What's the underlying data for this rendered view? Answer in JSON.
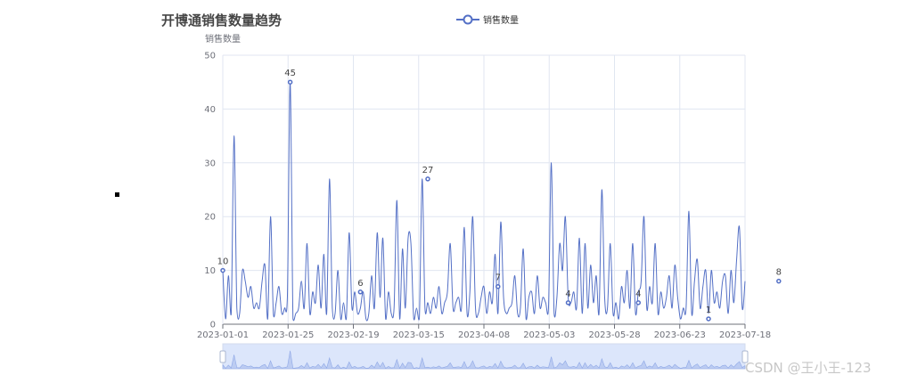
{
  "chart_data": {
    "type": "line",
    "title": "开博通销售数量趋势",
    "legend": [
      "销售数量"
    ],
    "legend_position": "top-center",
    "ylabel": "销售数量",
    "xlabel": "",
    "ylim": [
      0,
      50
    ],
    "yticks": [
      0,
      10,
      20,
      30,
      40,
      50
    ],
    "x_tick_labels": [
      "2023-01-01",
      "2023-01-25",
      "2023-02-19",
      "2023-03-15",
      "2023-04-08",
      "2023-05-03",
      "2023-05-28",
      "2023-06-23",
      "2023-07-18"
    ],
    "grid": true,
    "smooth": true,
    "data_zoom_slider": true,
    "series": [
      {
        "name": "销售数量",
        "color": "#5470c6",
        "values": [
          10,
          1,
          9,
          2,
          35,
          3,
          2,
          10,
          8,
          5,
          7,
          3,
          4,
          3,
          8,
          11,
          1,
          20,
          2,
          4,
          7,
          2,
          3,
          5,
          45,
          1,
          2,
          3,
          8,
          3,
          15,
          2,
          6,
          4,
          11,
          3,
          13,
          2,
          27,
          3,
          2,
          10,
          1,
          4,
          1,
          17,
          3,
          6,
          2,
          3,
          6,
          1,
          2,
          9,
          3,
          17,
          5,
          16,
          1,
          6,
          2,
          3,
          23,
          1,
          14,
          3,
          16,
          15,
          1,
          3,
          1,
          27,
          3,
          4,
          2,
          5,
          3,
          7,
          2,
          4,
          6,
          15,
          3,
          4,
          5,
          3,
          18,
          2,
          6,
          20,
          3,
          2,
          5,
          7,
          2,
          6,
          4,
          13,
          2,
          19,
          5,
          2,
          3,
          4,
          9,
          2,
          3,
          14,
          1,
          5,
          6,
          2,
          9,
          3,
          5,
          4,
          3,
          30,
          2,
          5,
          15,
          10,
          20,
          5,
          4,
          6,
          3,
          16,
          2,
          15,
          3,
          11,
          4,
          9,
          2,
          25,
          5,
          3,
          15,
          2,
          4,
          1,
          7,
          4,
          10,
          3,
          15,
          2,
          6,
          8,
          20,
          3,
          7,
          4,
          15,
          2,
          6,
          3,
          5,
          9,
          3,
          11,
          5,
          1,
          3,
          3,
          21,
          2,
          8,
          12,
          3,
          7,
          10,
          2,
          10,
          4,
          6,
          3,
          8,
          9,
          2,
          10,
          4,
          12,
          18,
          3,
          8
        ]
      }
    ],
    "labeled_points": [
      {
        "index": 0,
        "value": 10
      },
      {
        "index": 24,
        "value": 45
      },
      {
        "index": 49,
        "value": 6
      },
      {
        "index": 73,
        "value": 27
      },
      {
        "index": 98,
        "value": 7
      },
      {
        "index": 123,
        "value": 4
      },
      {
        "index": 148,
        "value": 4
      },
      {
        "index": 173,
        "value": 1
      },
      {
        "index": 198,
        "value": 8
      }
    ]
  },
  "watermark": "CSDN @王小王-123"
}
